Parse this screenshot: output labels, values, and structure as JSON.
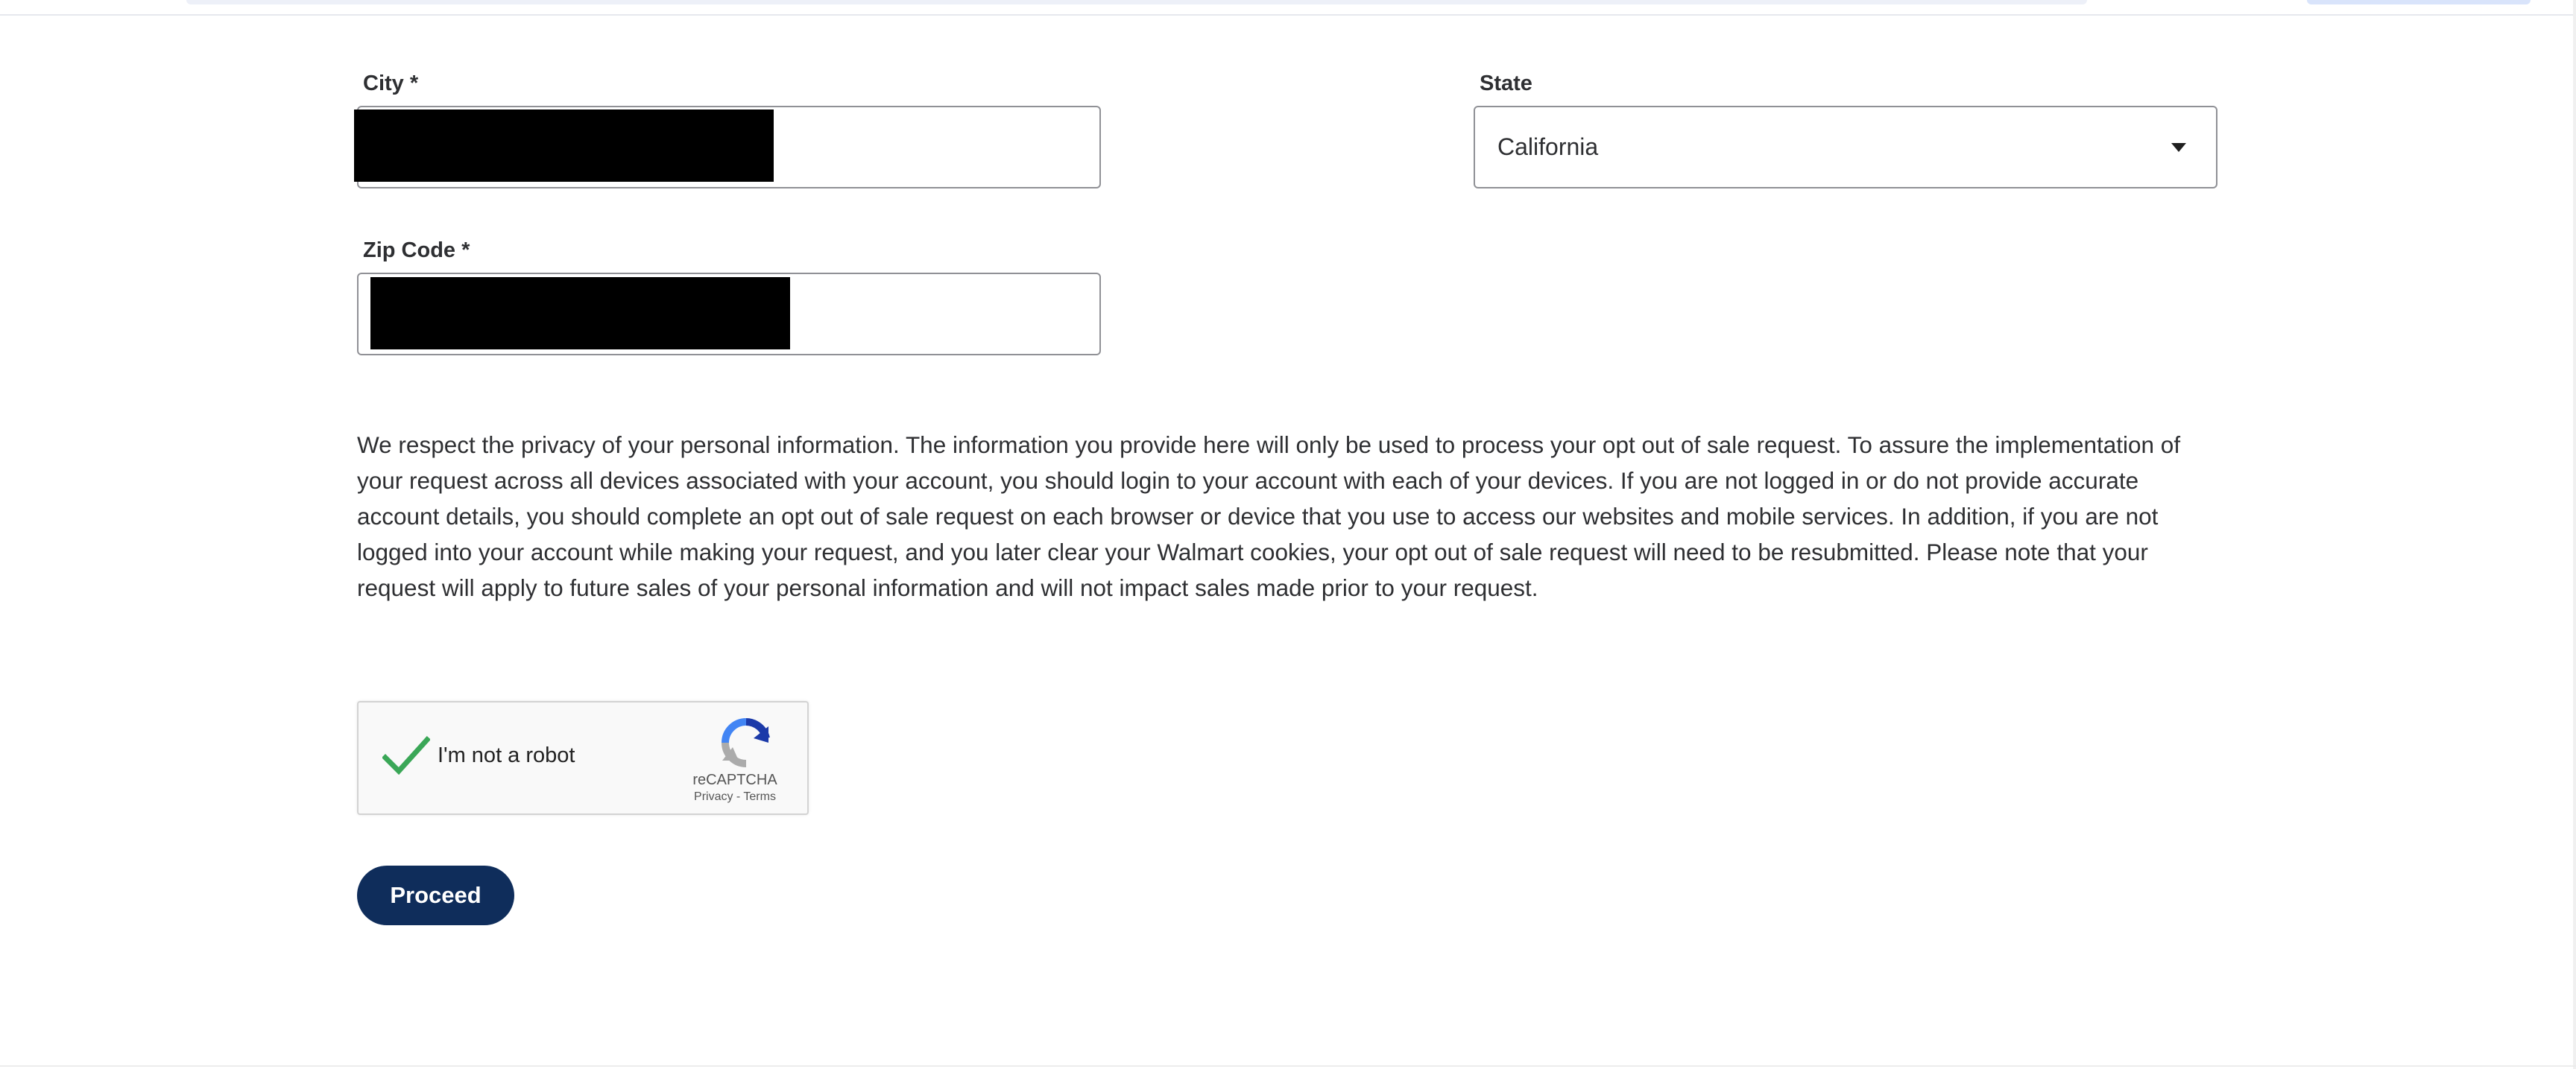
{
  "form": {
    "city": {
      "label": "City *"
    },
    "state": {
      "label": "State",
      "value": "California"
    },
    "zip": {
      "label": "Zip Code *"
    }
  },
  "notice": {
    "text": "We respect the privacy of your personal information. The information you provide here will only be used to process your opt out of sale request. To assure the implementation of your request across all devices associated with your account, you should login to your account with each of your devices. If you are not logged in or do not provide accurate account details, you should complete an opt out of sale request on each browser or device that you use to access our websites and mobile services. In addition, if you are not logged into your account while making your request, and you later clear your Walmart cookies, your opt out of sale request will need to be resubmitted. Please note that your request will apply to future sales of your personal information and will not impact sales made prior to your request."
  },
  "captcha": {
    "label": "I'm not a robot",
    "brand": "reCAPTCHA",
    "privacy": "Privacy",
    "separator": " - ",
    "terms": "Terms",
    "checked": true
  },
  "actions": {
    "proceed_label": "Proceed"
  },
  "colors": {
    "button_bg": "#0f2d5b",
    "check_green": "#3aa757",
    "redaction": "#000000"
  },
  "icons": {
    "state_dropdown": "chevron-down-icon",
    "captcha_check": "check-icon",
    "captcha_logo": "recaptcha-logo-icon"
  }
}
